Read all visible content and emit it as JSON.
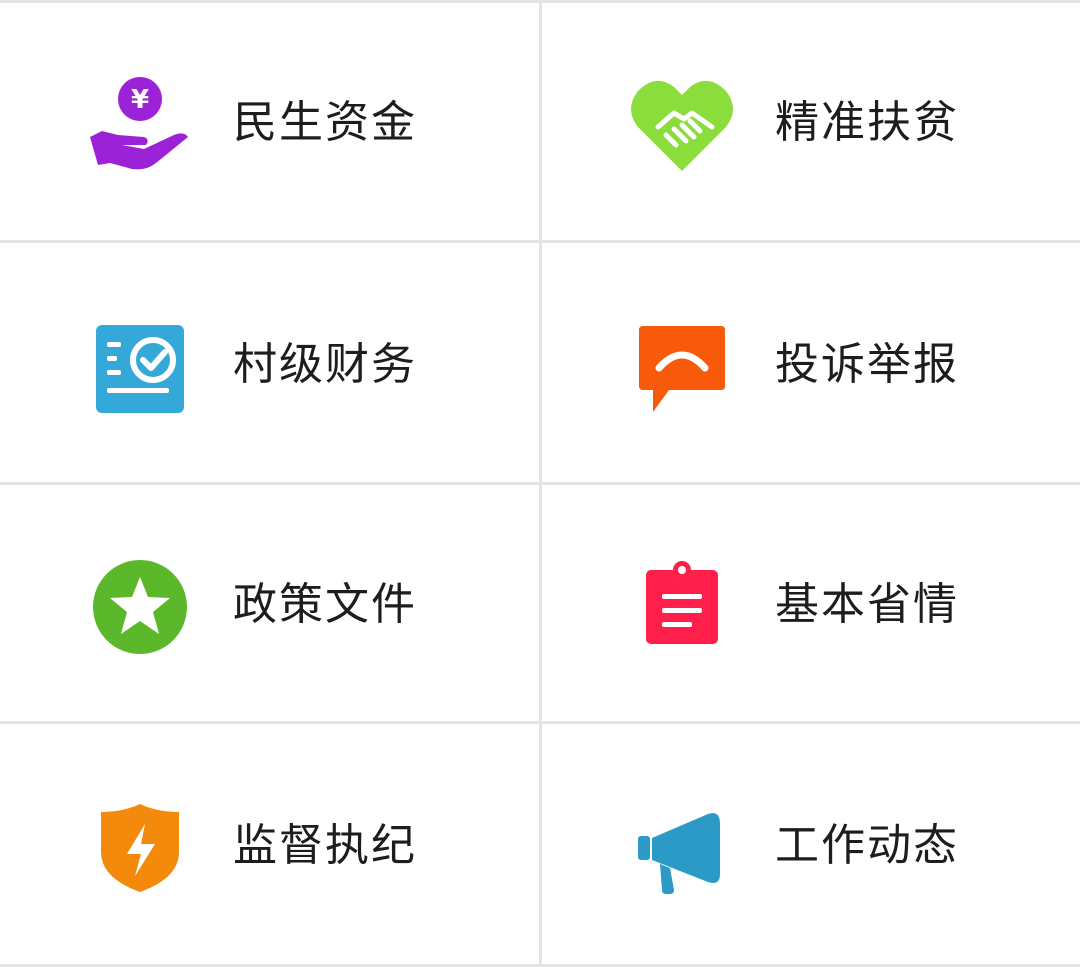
{
  "menu": {
    "items": [
      {
        "label": "民生资金",
        "icon": "hand-yuan-icon",
        "color": "#9b22d6"
      },
      {
        "label": "精准扶贫",
        "icon": "handshake-heart-icon",
        "color": "#8bdd3b"
      },
      {
        "label": "村级财务",
        "icon": "checklist-icon",
        "color": "#34a8d8"
      },
      {
        "label": "投诉举报",
        "icon": "speech-bubble-icon",
        "color": "#f85a0c"
      },
      {
        "label": "政策文件",
        "icon": "star-circle-icon",
        "color": "#5bb82a"
      },
      {
        "label": "基本省情",
        "icon": "clipboard-icon",
        "color": "#ff1f4a"
      },
      {
        "label": "监督执纪",
        "icon": "shield-lightning-icon",
        "color": "#f48a0c"
      },
      {
        "label": "工作动态",
        "icon": "megaphone-icon",
        "color": "#2b9ac6"
      }
    ]
  }
}
